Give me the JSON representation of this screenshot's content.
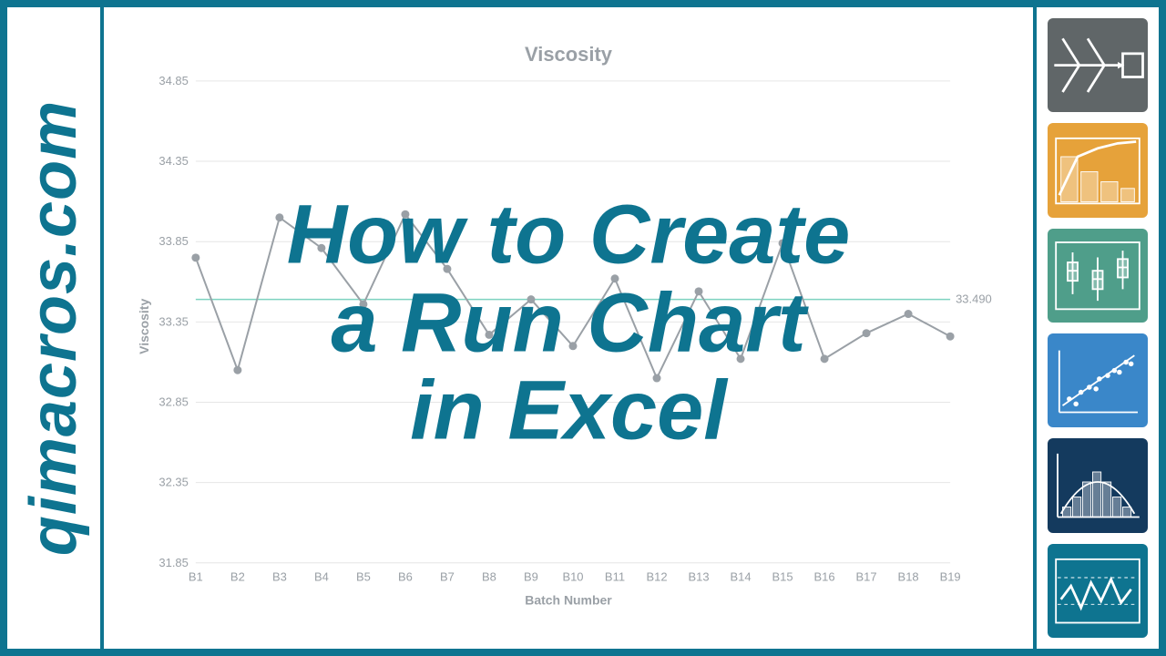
{
  "left": {
    "site": "qimacros.com"
  },
  "overlay": {
    "line1": "How to Create",
    "line2": "a Run Chart",
    "line3": "in Excel"
  },
  "thumbs": {
    "fishbone": "fishbone-diagram",
    "pareto": "pareto-chart",
    "box": "box-plot",
    "scatter": "scatter-plot",
    "hist": "histogram",
    "run": "run-chart"
  },
  "chart_data": {
    "type": "line",
    "title": "Viscosity",
    "xlabel": "Batch Number",
    "ylabel": "Viscosity",
    "ylim": [
      31.85,
      34.85
    ],
    "yticks": [
      31.85,
      32.35,
      32.85,
      33.35,
      33.85,
      34.35,
      34.85
    ],
    "categories": [
      "B1",
      "B2",
      "B3",
      "B4",
      "B5",
      "B6",
      "B7",
      "B8",
      "B9",
      "B10",
      "B11",
      "B12",
      "B13",
      "B14",
      "B15",
      "B16",
      "B17",
      "B18",
      "B19"
    ],
    "values": [
      33.75,
      33.05,
      34.0,
      33.81,
      33.46,
      34.02,
      33.68,
      33.27,
      33.49,
      33.2,
      33.62,
      33.0,
      33.54,
      33.12,
      33.84,
      33.12,
      33.28,
      33.4,
      33.26
    ],
    "median": 33.49,
    "median_label": "33.490"
  },
  "colors": {
    "accent": "#0e7490",
    "chart_text": "#9aa0a6",
    "chart_line": "#9aa0a6",
    "median_line": "#7dd3c0"
  }
}
